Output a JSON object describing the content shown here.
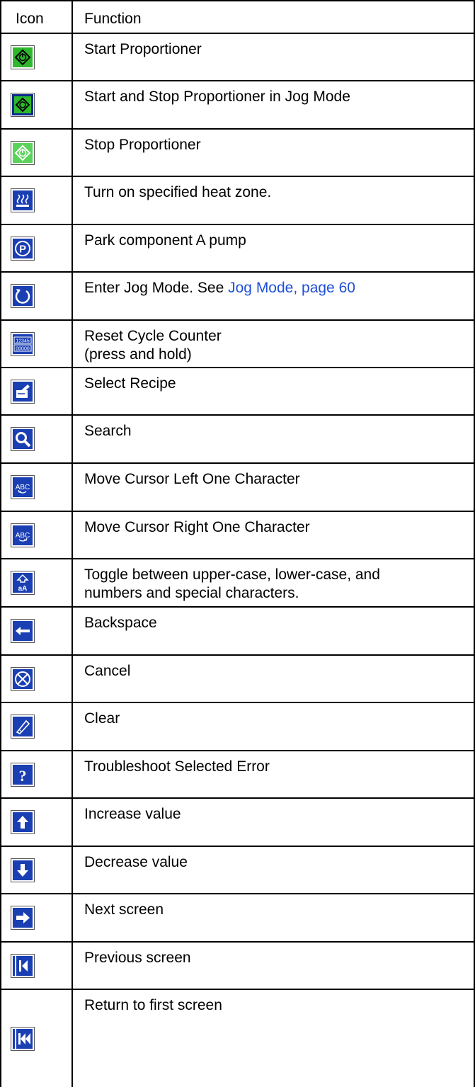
{
  "header": {
    "icon_col": "Icon",
    "function_col": "Function"
  },
  "rows": [
    {
      "icon": "start-proportioner-icon",
      "text": "Start Proportioner"
    },
    {
      "icon": "jog-start-stop-icon",
      "text": "Start and Stop Proportioner in Jog Mode"
    },
    {
      "icon": "stop-proportioner-icon",
      "text": "Stop Proportioner"
    },
    {
      "icon": "heat-zone-icon",
      "text": "Turn on specified heat zone."
    },
    {
      "icon": "park-pump-icon",
      "text": "Park component A pump"
    },
    {
      "icon": "jog-mode-icon",
      "text": "Enter Jog Mode. See ",
      "link": "Jog Mode, page 60"
    },
    {
      "icon": "reset-counter-icon",
      "text": "Reset Cycle Counter",
      "text2": "(press and hold)"
    },
    {
      "icon": "select-recipe-icon",
      "text": "Select Recipe"
    },
    {
      "icon": "search-icon",
      "text": "Search"
    },
    {
      "icon": "cursor-left-icon",
      "text": "Move Cursor Left One Character"
    },
    {
      "icon": "cursor-right-icon",
      "text": "Move Cursor Right One Character"
    },
    {
      "icon": "toggle-case-icon",
      "text": "Toggle between upper-case, lower-case, and",
      "text2": "numbers and special characters."
    },
    {
      "icon": "backspace-icon",
      "text": "Backspace"
    },
    {
      "icon": "cancel-icon",
      "text": "Cancel"
    },
    {
      "icon": "clear-icon",
      "text": "Clear"
    },
    {
      "icon": "troubleshoot-icon",
      "text": "Troubleshoot Selected Error"
    },
    {
      "icon": "increase-icon",
      "text": "Increase value"
    },
    {
      "icon": "decrease-icon",
      "text": "Decrease value"
    },
    {
      "icon": "next-screen-icon",
      "text": "Next screen"
    },
    {
      "icon": "previous-screen-icon",
      "text": "Previous screen"
    },
    {
      "icon": "first-screen-icon",
      "text": "Return to first screen"
    }
  ],
  "icon_texts": {
    "counter_top": "12345",
    "counter_bottom": "00000",
    "abc": "ABC",
    "case": "aA"
  },
  "colors": {
    "green": "#2db82d",
    "green_light": "#5ad35a",
    "blue": "#1a3fb3",
    "blue_dark": "#0d2a8c",
    "link": "#1f4fd8"
  }
}
